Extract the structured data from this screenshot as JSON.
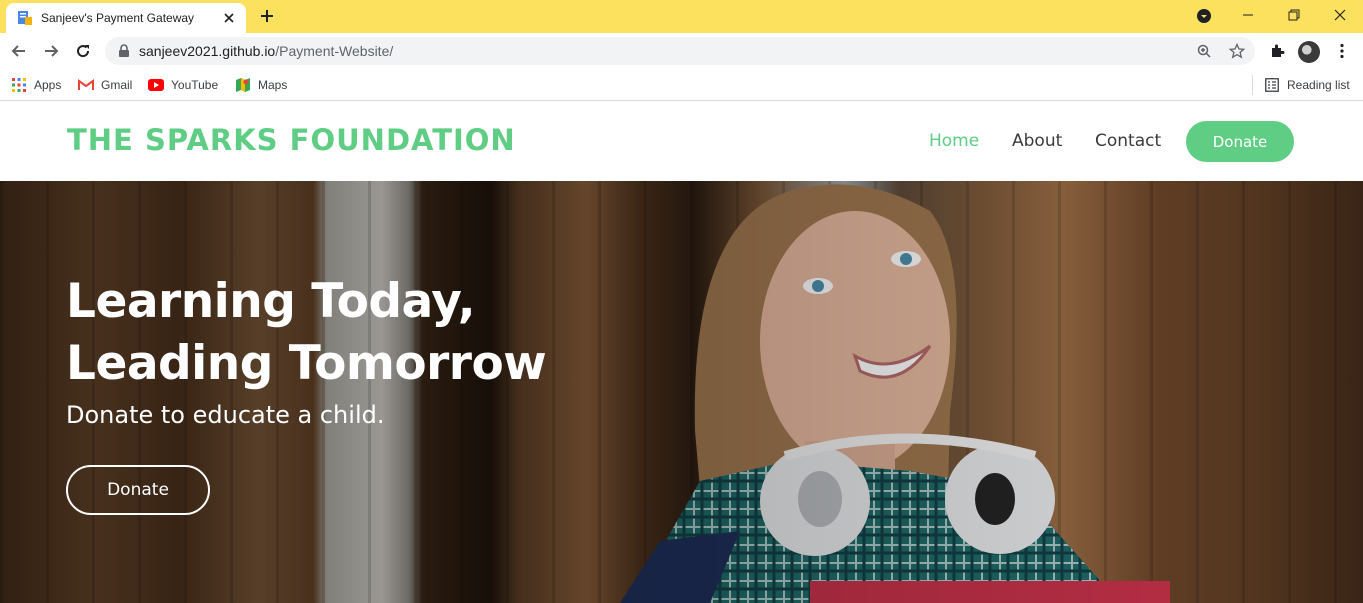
{
  "browser": {
    "tab": {
      "title": "Sanjeev's Payment Gateway",
      "favicon": "page-icon"
    },
    "url": {
      "domain": "sanjeev2021.github.io",
      "path": "/Payment-Website/"
    },
    "bookmarks": [
      {
        "label": "Apps",
        "icon": "apps-grid-icon"
      },
      {
        "label": "Gmail",
        "icon": "gmail-icon"
      },
      {
        "label": "YouTube",
        "icon": "youtube-icon"
      },
      {
        "label": "Maps",
        "icon": "maps-icon"
      }
    ],
    "reading_list": "Reading list",
    "accent_color": "#fbe15d"
  },
  "site": {
    "brand": "THE SPARKS FOUNDATION",
    "nav": [
      {
        "label": "Home",
        "active": true
      },
      {
        "label": "About",
        "active": false
      },
      {
        "label": "Contact",
        "active": false
      }
    ],
    "nav_donate": "Donate",
    "brand_color": "#5fcd84",
    "hero": {
      "title_line1": "Learning Today,",
      "title_line2": "Leading Tomorrow",
      "subtitle": "Donate to educate a child.",
      "cta": "Donate"
    }
  }
}
